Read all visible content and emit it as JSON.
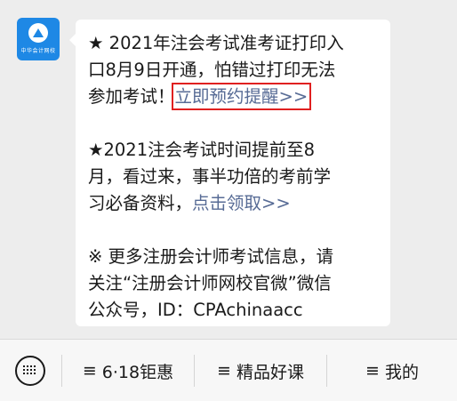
{
  "account": {
    "avatar_text": "中华会计网校"
  },
  "message": {
    "paragraphs": [
      {
        "lines": [
          "★ 2021年注会考试准考证打印入",
          "口8月9日开通，怕错过打印无法"
        ],
        "tail_text": "参加考试！",
        "link_text": "立即预约提醒>>"
      },
      {
        "lines": [
          "★2021注会考试时间提前至8",
          "月，看过来，事半功倍的考前学"
        ],
        "tail_text": "习必备资料，",
        "link_text": "点击领取>>"
      },
      {
        "lines": [
          "※ 更多注册会计师考试信息，请",
          "关注“注册会计师网校官微”微信",
          "公众号，ID：CPAchinaacc"
        ]
      }
    ]
  },
  "menu": {
    "keyboard_icon": "keyboard-icon",
    "burger_glyph": "≡",
    "items": [
      {
        "label": "6·18钜惠"
      },
      {
        "label": "精品好课"
      },
      {
        "label": "我的"
      }
    ]
  },
  "colors": {
    "background": "#ededed",
    "link": "#576b95",
    "highlight_box": "#e02020",
    "avatar": "#1e88e5"
  }
}
